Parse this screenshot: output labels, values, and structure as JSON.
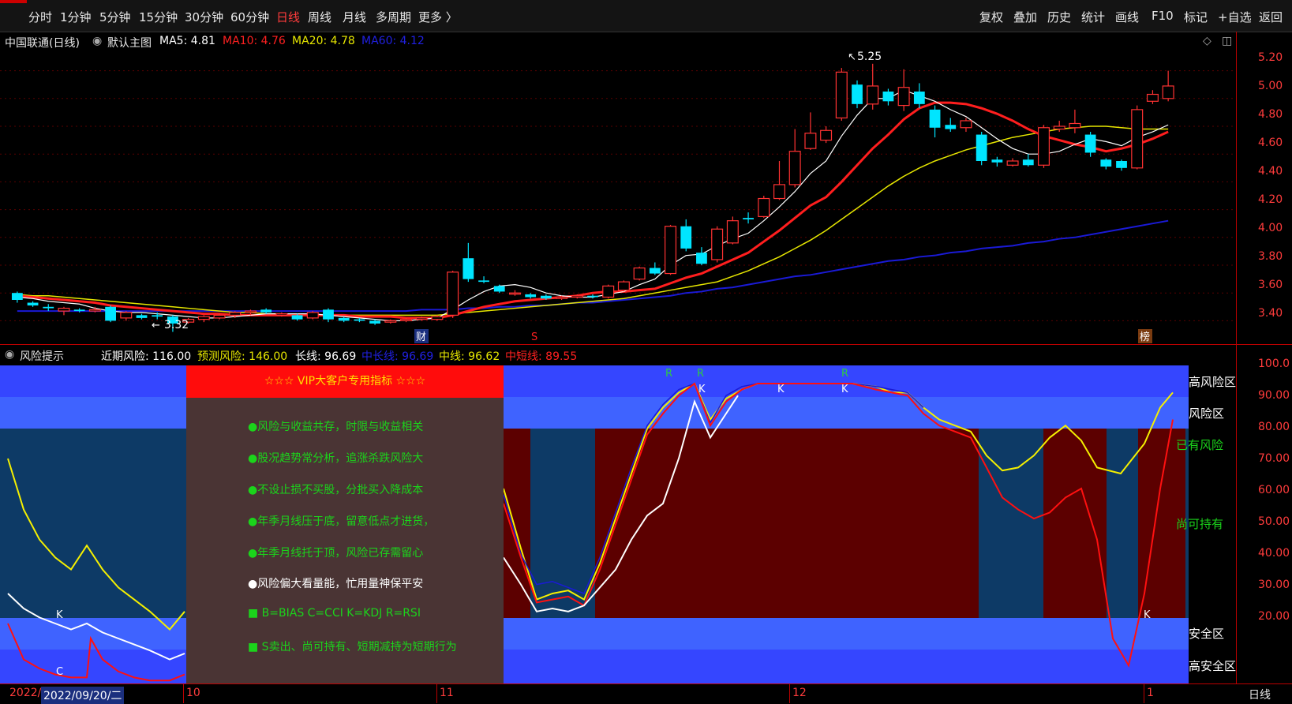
{
  "toolbar": {
    "periods": [
      "分时",
      "1分钟",
      "5分钟",
      "15分钟",
      "30分钟",
      "60分钟",
      "日线",
      "周线",
      "月线",
      "多周期",
      "更多 〉"
    ],
    "active_period": "日线",
    "tools": [
      "复权",
      "叠加",
      "历史",
      "统计",
      "画线",
      "F10",
      "标记",
      "+自选",
      "返回"
    ]
  },
  "info": {
    "title": "中国联通(日线)",
    "template_label": "默认主图",
    "ma5": "MA5: 4.81",
    "ma10": "MA10: 4.76",
    "ma20": "MA20: 4.78",
    "ma60": "MA60: 4.12"
  },
  "price_axis": [
    "5.20",
    "5.00",
    "4.80",
    "4.60",
    "4.40",
    "4.20",
    "4.00",
    "3.80",
    "3.60",
    "3.40"
  ],
  "price_marks": {
    "high": "5.25",
    "low": "3.32",
    "event_cai": "财",
    "event_s": "S",
    "event_bang": "榜"
  },
  "indicator": {
    "name": "风险提示",
    "near_risk": "近期风险: 116.00",
    "forecast_risk": "预测风险: 146.00",
    "long_line": "长线: 96.69",
    "mid_long_line": "中长线: 96.69",
    "mid_line": "中线: 96.62",
    "mid_short_line": "中短线: 89.55",
    "axis": [
      "100.0",
      "90.00",
      "80.00",
      "70.00",
      "60.00",
      "50.00",
      "40.00",
      "30.00",
      "20.00"
    ],
    "zones": {
      "high_risk": "高风险区",
      "risk": "风险区",
      "has_risk": "已有风险",
      "can_hold": "尚可持有",
      "safe": "安全区",
      "high_safe": "高安全区"
    },
    "markers": [
      "R",
      "R",
      "K",
      "K",
      "K",
      "R",
      "K",
      "C",
      "K"
    ]
  },
  "vip": {
    "header": "☆☆☆  VIP大客户专用指标  ☆☆☆",
    "tips": [
      "●风险与收益共存，时限与收益相关",
      "●股况趋势常分析，追涨杀跌风险大",
      "●不设止损不买股，分批买入降成本",
      "●年季月线压于底，留意低点才进货，",
      "●年季月线托于顶，风险已存需留心",
      "●风险偏大看量能，忙用量神保平安",
      "■ B=BIAS    C=CCI     K=KDJ     R=RSI",
      "■ S卖出、尚可持有、短期减持为短期行为"
    ]
  },
  "bottom": {
    "year": "2022/",
    "date": "2022/09/20/二",
    "months": [
      "10",
      "11",
      "12",
      "1"
    ],
    "period": "日线"
  },
  "colors": {
    "up": "#ff3232",
    "down": "#00e5ff",
    "ma5": "#ffffff",
    "ma10": "#ff1e1e",
    "ma20": "#e6e600",
    "ma60": "#1a1ad6"
  },
  "chart_data": {
    "type": "candlestick",
    "ylim": [
      3.3,
      5.3
    ],
    "candles": [
      {
        "o": 3.6,
        "c": 3.55,
        "h": 3.61,
        "l": 3.53
      },
      {
        "o": 3.53,
        "c": 3.51,
        "h": 3.54,
        "l": 3.5
      },
      {
        "o": 3.5,
        "c": 3.49,
        "h": 3.52,
        "l": 3.47
      },
      {
        "o": 3.47,
        "c": 3.49,
        "h": 3.5,
        "l": 3.44
      },
      {
        "o": 3.48,
        "c": 3.47,
        "h": 3.49,
        "l": 3.46
      },
      {
        "o": 3.47,
        "c": 3.48,
        "h": 3.5,
        "l": 3.46
      },
      {
        "o": 3.5,
        "c": 3.4,
        "h": 3.51,
        "l": 3.39
      },
      {
        "o": 3.42,
        "c": 3.46,
        "h": 3.47,
        "l": 3.4
      },
      {
        "o": 3.44,
        "c": 3.42,
        "h": 3.45,
        "l": 3.41
      },
      {
        "o": 3.44,
        "c": 3.43,
        "h": 3.46,
        "l": 3.41
      },
      {
        "o": 3.43,
        "c": 3.38,
        "h": 3.44,
        "l": 3.32
      },
      {
        "o": 3.39,
        "c": 3.41,
        "h": 3.42,
        "l": 3.38
      },
      {
        "o": 3.41,
        "c": 3.43,
        "h": 3.44,
        "l": 3.39
      },
      {
        "o": 3.42,
        "c": 3.44,
        "h": 3.45,
        "l": 3.41
      },
      {
        "o": 3.44,
        "c": 3.46,
        "h": 3.47,
        "l": 3.42
      },
      {
        "o": 3.46,
        "c": 3.47,
        "h": 3.48,
        "l": 3.44
      },
      {
        "o": 3.48,
        "c": 3.46,
        "h": 3.49,
        "l": 3.45
      },
      {
        "o": 3.44,
        "c": 3.45,
        "h": 3.46,
        "l": 3.43
      },
      {
        "o": 3.44,
        "c": 3.41,
        "h": 3.45,
        "l": 3.4
      },
      {
        "o": 3.42,
        "c": 3.46,
        "h": 3.47,
        "l": 3.41
      },
      {
        "o": 3.48,
        "c": 3.41,
        "h": 3.49,
        "l": 3.39
      },
      {
        "o": 3.42,
        "c": 3.4,
        "h": 3.43,
        "l": 3.39
      },
      {
        "o": 3.41,
        "c": 3.4,
        "h": 3.42,
        "l": 3.39
      },
      {
        "o": 3.4,
        "c": 3.38,
        "h": 3.41,
        "l": 3.37
      },
      {
        "o": 3.39,
        "c": 3.4,
        "h": 3.41,
        "l": 3.38
      },
      {
        "o": 3.4,
        "c": 3.41,
        "h": 3.42,
        "l": 3.39
      },
      {
        "o": 3.41,
        "c": 3.42,
        "h": 3.43,
        "l": 3.4
      },
      {
        "o": 3.41,
        "c": 3.43,
        "h": 3.44,
        "l": 3.4
      },
      {
        "o": 3.44,
        "c": 3.75,
        "h": 3.76,
        "l": 3.42
      },
      {
        "o": 3.85,
        "c": 3.7,
        "h": 3.96,
        "l": 3.68
      },
      {
        "o": 3.69,
        "c": 3.68,
        "h": 3.72,
        "l": 3.67
      },
      {
        "o": 3.65,
        "c": 3.61,
        "h": 3.66,
        "l": 3.6
      },
      {
        "o": 3.6,
        "c": 3.6,
        "h": 3.62,
        "l": 3.58
      },
      {
        "o": 3.59,
        "c": 3.57,
        "h": 3.6,
        "l": 3.56
      },
      {
        "o": 3.58,
        "c": 3.56,
        "h": 3.59,
        "l": 3.55
      },
      {
        "o": 3.56,
        "c": 3.57,
        "h": 3.58,
        "l": 3.55
      },
      {
        "o": 3.57,
        "c": 3.58,
        "h": 3.59,
        "l": 3.56
      },
      {
        "o": 3.58,
        "c": 3.57,
        "h": 3.59,
        "l": 3.56
      },
      {
        "o": 3.57,
        "c": 3.65,
        "h": 3.66,
        "l": 3.56
      },
      {
        "o": 3.62,
        "c": 3.68,
        "h": 3.69,
        "l": 3.61
      },
      {
        "o": 3.7,
        "c": 3.78,
        "h": 3.79,
        "l": 3.69
      },
      {
        "o": 3.78,
        "c": 3.74,
        "h": 3.82,
        "l": 3.73
      },
      {
        "o": 3.74,
        "c": 4.08,
        "h": 4.09,
        "l": 3.73
      },
      {
        "o": 4.08,
        "c": 3.92,
        "h": 4.13,
        "l": 3.9
      },
      {
        "o": 3.89,
        "c": 3.81,
        "h": 3.93,
        "l": 3.8
      },
      {
        "o": 3.84,
        "c": 4.06,
        "h": 4.08,
        "l": 3.82
      },
      {
        "o": 3.96,
        "c": 4.12,
        "h": 4.15,
        "l": 3.95
      },
      {
        "o": 4.14,
        "c": 4.13,
        "h": 4.18,
        "l": 4.1
      },
      {
        "o": 4.15,
        "c": 4.28,
        "h": 4.3,
        "l": 4.14
      },
      {
        "o": 4.28,
        "c": 4.38,
        "h": 4.55,
        "l": 4.27
      },
      {
        "o": 4.38,
        "c": 4.62,
        "h": 4.78,
        "l": 4.36
      },
      {
        "o": 4.64,
        "c": 4.75,
        "h": 4.9,
        "l": 4.63
      },
      {
        "o": 4.7,
        "c": 4.77,
        "h": 4.8,
        "l": 4.68
      },
      {
        "o": 4.86,
        "c": 5.19,
        "h": 5.22,
        "l": 4.84
      },
      {
        "o": 5.1,
        "c": 4.96,
        "h": 5.13,
        "l": 4.93
      },
      {
        "o": 4.96,
        "c": 5.09,
        "h": 5.25,
        "l": 4.92
      },
      {
        "o": 5.05,
        "c": 4.98,
        "h": 5.07,
        "l": 4.95
      },
      {
        "o": 4.95,
        "c": 5.08,
        "h": 5.21,
        "l": 4.91
      },
      {
        "o": 5.05,
        "c": 4.96,
        "h": 5.11,
        "l": 4.93
      },
      {
        "o": 4.92,
        "c": 4.79,
        "h": 4.95,
        "l": 4.72
      },
      {
        "o": 4.81,
        "c": 4.78,
        "h": 4.86,
        "l": 4.76
      },
      {
        "o": 4.79,
        "c": 4.84,
        "h": 4.86,
        "l": 4.76
      },
      {
        "o": 4.74,
        "c": 4.55,
        "h": 4.76,
        "l": 4.52
      },
      {
        "o": 4.56,
        "c": 4.54,
        "h": 4.58,
        "l": 4.51
      },
      {
        "o": 4.52,
        "c": 4.55,
        "h": 4.57,
        "l": 4.51
      },
      {
        "o": 4.56,
        "c": 4.52,
        "h": 4.6,
        "l": 4.51
      },
      {
        "o": 4.52,
        "c": 4.79,
        "h": 4.81,
        "l": 4.5
      },
      {
        "o": 4.78,
        "c": 4.8,
        "h": 4.84,
        "l": 4.76
      },
      {
        "o": 4.79,
        "c": 4.82,
        "h": 4.92,
        "l": 4.75
      },
      {
        "o": 4.74,
        "c": 4.61,
        "h": 4.76,
        "l": 4.58
      },
      {
        "o": 4.56,
        "c": 4.51,
        "h": 4.57,
        "l": 4.49
      },
      {
        "o": 4.55,
        "c": 4.5,
        "h": 4.56,
        "l": 4.48
      },
      {
        "o": 4.5,
        "c": 4.92,
        "h": 4.95,
        "l": 4.49
      },
      {
        "o": 4.98,
        "c": 5.03,
        "h": 5.06,
        "l": 4.96
      },
      {
        "o": 5.0,
        "c": 5.09,
        "h": 5.2,
        "l": 4.98
      }
    ],
    "ma5": [
      3.57,
      3.56,
      3.54,
      3.53,
      3.52,
      3.49,
      3.47,
      3.46,
      3.46,
      3.45,
      3.44,
      3.43,
      3.42,
      3.42,
      3.43,
      3.44,
      3.45,
      3.45,
      3.45,
      3.45,
      3.44,
      3.43,
      3.42,
      3.41,
      3.4,
      3.4,
      3.41,
      3.42,
      3.48,
      3.55,
      3.61,
      3.65,
      3.66,
      3.64,
      3.6,
      3.58,
      3.57,
      3.57,
      3.59,
      3.61,
      3.66,
      3.7,
      3.8,
      3.87,
      3.88,
      3.94,
      3.99,
      4.03,
      4.12,
      4.22,
      4.33,
      4.46,
      4.55,
      4.73,
      4.88,
      5.0,
      5.0,
      5.06,
      5.02,
      4.98,
      4.92,
      4.87,
      4.79,
      4.71,
      4.64,
      4.6,
      4.6,
      4.62,
      4.67,
      4.71,
      4.69,
      4.66,
      4.72,
      4.76,
      4.81
    ],
    "ma10": [
      3.58,
      3.57,
      3.56,
      3.55,
      3.54,
      3.53,
      3.51,
      3.5,
      3.49,
      3.48,
      3.47,
      3.46,
      3.45,
      3.45,
      3.44,
      3.44,
      3.44,
      3.44,
      3.44,
      3.44,
      3.44,
      3.44,
      3.43,
      3.43,
      3.43,
      3.42,
      3.42,
      3.42,
      3.44,
      3.47,
      3.5,
      3.52,
      3.54,
      3.55,
      3.56,
      3.57,
      3.58,
      3.6,
      3.61,
      3.61,
      3.62,
      3.63,
      3.67,
      3.71,
      3.74,
      3.79,
      3.84,
      3.89,
      3.97,
      4.05,
      4.14,
      4.23,
      4.29,
      4.4,
      4.52,
      4.64,
      4.74,
      4.85,
      4.93,
      4.97,
      4.97,
      4.96,
      4.93,
      4.89,
      4.84,
      4.78,
      4.73,
      4.7,
      4.67,
      4.65,
      4.62,
      4.64,
      4.67,
      4.71,
      4.76
    ],
    "ma20": [
      3.59,
      3.58,
      3.58,
      3.57,
      3.56,
      3.55,
      3.54,
      3.53,
      3.52,
      3.51,
      3.5,
      3.49,
      3.48,
      3.47,
      3.46,
      3.46,
      3.45,
      3.45,
      3.44,
      3.44,
      3.44,
      3.44,
      3.44,
      3.44,
      3.44,
      3.44,
      3.44,
      3.44,
      3.45,
      3.46,
      3.47,
      3.48,
      3.49,
      3.5,
      3.51,
      3.52,
      3.53,
      3.54,
      3.55,
      3.56,
      3.58,
      3.6,
      3.62,
      3.64,
      3.66,
      3.68,
      3.72,
      3.76,
      3.81,
      3.86,
      3.92,
      3.98,
      4.05,
      4.13,
      4.21,
      4.29,
      4.37,
      4.44,
      4.5,
      4.55,
      4.59,
      4.63,
      4.66,
      4.69,
      4.72,
      4.74,
      4.76,
      4.78,
      4.79,
      4.8,
      4.8,
      4.79,
      4.78,
      4.78,
      4.78
    ],
    "ma60": [
      3.47,
      3.47,
      3.47,
      3.47,
      3.47,
      3.47,
      3.47,
      3.47,
      3.47,
      3.47,
      3.47,
      3.47,
      3.47,
      3.47,
      3.47,
      3.47,
      3.47,
      3.47,
      3.47,
      3.47,
      3.47,
      3.47,
      3.47,
      3.47,
      3.47,
      3.47,
      3.48,
      3.48,
      3.48,
      3.49,
      3.49,
      3.5,
      3.5,
      3.51,
      3.51,
      3.52,
      3.53,
      3.53,
      3.54,
      3.55,
      3.56,
      3.57,
      3.58,
      3.6,
      3.61,
      3.63,
      3.64,
      3.66,
      3.68,
      3.7,
      3.72,
      3.73,
      3.75,
      3.77,
      3.79,
      3.81,
      3.83,
      3.84,
      3.86,
      3.87,
      3.89,
      3.9,
      3.92,
      3.93,
      3.94,
      3.96,
      3.97,
      3.99,
      4.0,
      4.02,
      4.04,
      4.06,
      4.08,
      4.1,
      4.12
    ],
    "risk_lines": {
      "yellow": [
        75,
        58,
        48,
        42,
        38,
        46,
        38,
        32,
        28,
        24,
        18,
        24
      ],
      "white": [
        30,
        25,
        22,
        20,
        18,
        20,
        17,
        15,
        13,
        11,
        8,
        10
      ],
      "red": [
        20,
        8,
        5,
        3,
        2,
        2,
        15,
        8,
        4,
        2,
        1,
        1,
        3
      ]
    }
  }
}
